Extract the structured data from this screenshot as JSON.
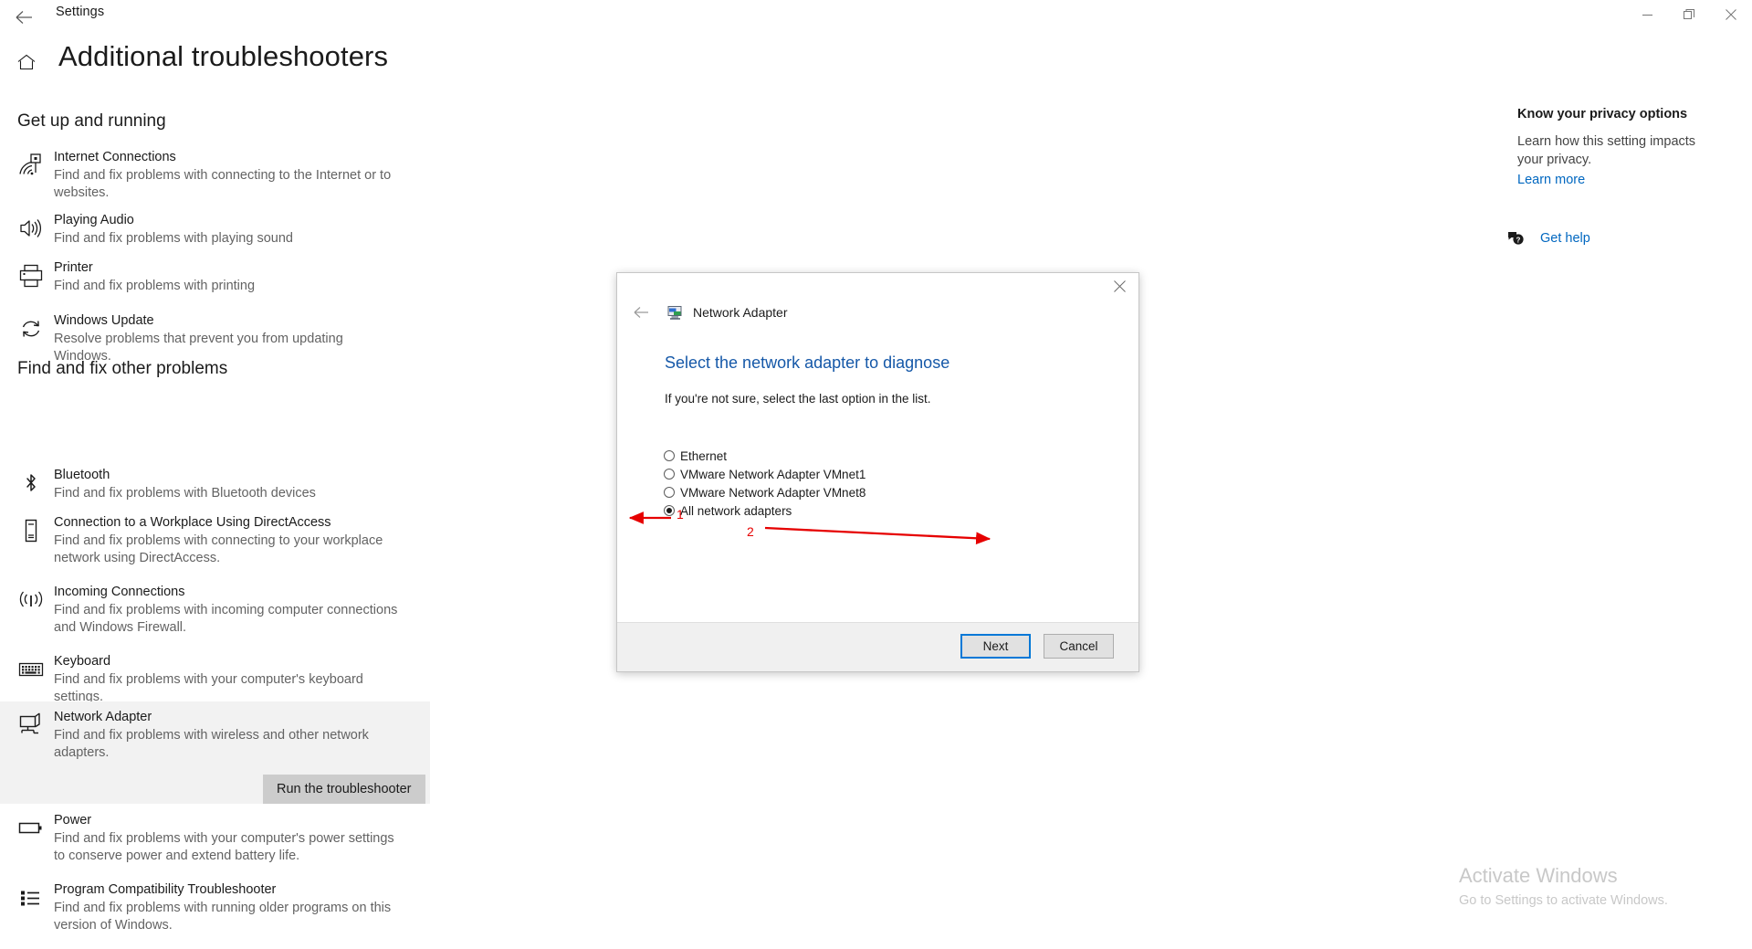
{
  "window": {
    "title": "Settings",
    "back_icon": "back-arrow-icon",
    "controls": [
      {
        "name": "minimize",
        "label": "—"
      },
      {
        "name": "maximize",
        "label": "❐"
      },
      {
        "name": "close",
        "label": "✕"
      }
    ]
  },
  "page": {
    "home_icon": "home-icon",
    "title": "Additional troubleshooters"
  },
  "sections": [
    {
      "id": "get-up-and-running",
      "heading": "Get up and running",
      "items": [
        {
          "icon": "internet-connections-icon",
          "name": "Internet Connections",
          "desc": "Find and fix problems with connecting to the Internet or to websites."
        },
        {
          "icon": "speaker-icon",
          "name": "Playing Audio",
          "desc": "Find and fix problems with playing sound"
        },
        {
          "icon": "printer-icon",
          "name": "Printer",
          "desc": "Find and fix problems with printing"
        },
        {
          "icon": "refresh-icon",
          "name": "Windows Update",
          "desc": "Resolve problems that prevent you from updating Windows."
        }
      ]
    },
    {
      "id": "find-and-fix-other-problems",
      "heading": "Find and fix other problems",
      "items": [
        {
          "icon": "bluetooth-icon",
          "name": "Bluetooth",
          "desc": "Find and fix problems with Bluetooth devices"
        },
        {
          "icon": "smartcard-icon",
          "name": "Connection to a Workplace Using DirectAccess",
          "desc": "Find and fix problems with connecting to your workplace network using DirectAccess."
        },
        {
          "icon": "antenna-icon",
          "name": "Incoming Connections",
          "desc": "Find and fix problems with incoming computer connections and Windows Firewall."
        },
        {
          "icon": "keyboard-icon",
          "name": "Keyboard",
          "desc": "Find and fix problems with your computer's keyboard settings."
        },
        {
          "icon": "network-adapter-icon",
          "name": "Network Adapter",
          "desc": "Find and fix problems with wireless and other network adapters.",
          "selected": true,
          "action_label": "Run the troubleshooter"
        },
        {
          "icon": "battery-icon",
          "name": "Power",
          "desc": "Find and fix problems with your computer's power settings to conserve power and extend battery life."
        },
        {
          "icon": "list-icon",
          "name": "Program Compatibility Troubleshooter",
          "desc": "Find and fix problems with running older programs on this version of Windows."
        }
      ]
    }
  ],
  "right_panel": {
    "heading": "Know your privacy options",
    "description": "Learn how this setting impacts your privacy.",
    "link": "Learn more",
    "help_icon": "question-bubble-icon",
    "help_label": "Get help"
  },
  "watermark": {
    "title": "Activate Windows",
    "subtitle": "Go to Settings to activate Windows."
  },
  "dialog": {
    "back_icon": "back-arrow-icon",
    "app_icon": "network-adapter-app-icon",
    "app_title": "Network Adapter",
    "close_icon": "close-icon",
    "heading": "Select the network adapter to diagnose",
    "subtext": "If you're not sure, select the last option in the list.",
    "options": [
      {
        "label": "Ethernet",
        "checked": false
      },
      {
        "label": "VMware Network Adapter VMnet1",
        "checked": false
      },
      {
        "label": "VMware Network Adapter VMnet8",
        "checked": false
      },
      {
        "label": "All network adapters",
        "checked": true
      }
    ],
    "buttons": {
      "next": "Next",
      "cancel": "Cancel"
    }
  },
  "annotations": {
    "step1": "1",
    "step2": "2",
    "color": "#e60000"
  }
}
